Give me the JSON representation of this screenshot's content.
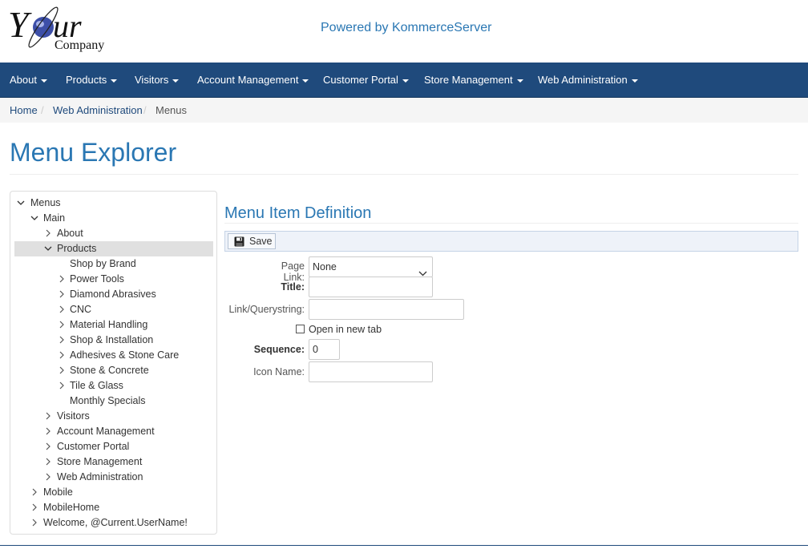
{
  "header": {
    "logo_text_main": "Your",
    "logo_text_sub": "Company",
    "powered_by": "Powered by KommerceServer"
  },
  "nav": {
    "items": [
      {
        "label": "About"
      },
      {
        "label": "Products"
      },
      {
        "label": "Visitors"
      },
      {
        "label": "Account Management"
      },
      {
        "label": "Customer Portal"
      },
      {
        "label": "Store Management"
      },
      {
        "label": "Web Administration"
      }
    ]
  },
  "breadcrumb": {
    "items": [
      {
        "label": "Home"
      },
      {
        "label": "Web Administration"
      },
      {
        "label": "Menus"
      }
    ],
    "separator": "/"
  },
  "page": {
    "title": "Menu Explorer"
  },
  "tree": {
    "nodes": [
      {
        "label": "Menus",
        "state": "expanded"
      },
      {
        "label": "Main",
        "state": "expanded"
      },
      {
        "label": "About",
        "state": "collapsed"
      },
      {
        "label": "Products",
        "state": "expanded",
        "selected": true
      },
      {
        "label": "Shop by Brand",
        "state": "leaf"
      },
      {
        "label": "Power Tools",
        "state": "collapsed"
      },
      {
        "label": "Diamond Abrasives",
        "state": "collapsed"
      },
      {
        "label": "CNC",
        "state": "collapsed"
      },
      {
        "label": "Material Handling",
        "state": "collapsed"
      },
      {
        "label": "Shop & Installation",
        "state": "collapsed"
      },
      {
        "label": "Adhesives & Stone Care",
        "state": "collapsed"
      },
      {
        "label": "Stone & Concrete",
        "state": "collapsed"
      },
      {
        "label": "Tile & Glass",
        "state": "collapsed"
      },
      {
        "label": "Monthly Specials",
        "state": "leaf"
      },
      {
        "label": "Visitors",
        "state": "collapsed"
      },
      {
        "label": "Account Management",
        "state": "collapsed"
      },
      {
        "label": "Customer Portal",
        "state": "collapsed"
      },
      {
        "label": "Store Management",
        "state": "collapsed"
      },
      {
        "label": "Web Administration",
        "state": "collapsed"
      },
      {
        "label": "Mobile",
        "state": "collapsed"
      },
      {
        "label": "MobileHome",
        "state": "collapsed"
      },
      {
        "label": "Welcome, @Current.UserName!",
        "state": "collapsed"
      }
    ]
  },
  "form": {
    "title": "Menu Item Definition",
    "save_label": "Save",
    "page_link_label": "Page Link:",
    "page_link_value": "None",
    "title_label": "Title:",
    "title_value": "",
    "link_label": "Link/Querystring:",
    "link_value": "",
    "open_new_tab_label": "Open in new tab",
    "open_new_tab_checked": false,
    "sequence_label": "Sequence:",
    "sequence_value": "0",
    "icon_name_label": "Icon Name:",
    "icon_name_value": ""
  },
  "colors": {
    "navbar": "#1f4a7c",
    "accent": "#2a77b3",
    "selected_row": "#e0e0e0"
  }
}
